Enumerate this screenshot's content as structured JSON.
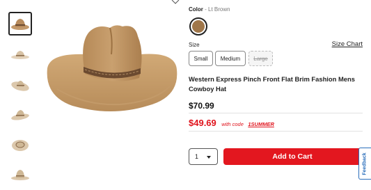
{
  "product": {
    "color_label": "Color",
    "color_separator": "-",
    "color_value": "Lt Brown",
    "swatch_color": "#a0774a",
    "size_label": "Size",
    "size_chart_link": "Size Chart",
    "sizes": [
      {
        "label": "Small",
        "available": true
      },
      {
        "label": "Medium",
        "available": true
      },
      {
        "label": "Large",
        "available": false
      }
    ],
    "title": "Western Express Pinch Front Flat Brim Fashion Mens Cowboy Hat",
    "price": "$70.99",
    "sale_price": "$49.69",
    "sale_note": "with code",
    "promo_code": "1SUMMER",
    "quantity": "1",
    "add_to_cart_label": "Add to Cart",
    "feedback_label": "Feedback"
  },
  "gallery": {
    "thumbnail_count": 6,
    "selected_index": 0,
    "hat_color": "#c49a6c",
    "band_color": "#6b4a30"
  },
  "colors": {
    "accent_red": "#e3171f",
    "sale_red": "#e0131c",
    "feedback_blue": "#2a6ebb"
  }
}
